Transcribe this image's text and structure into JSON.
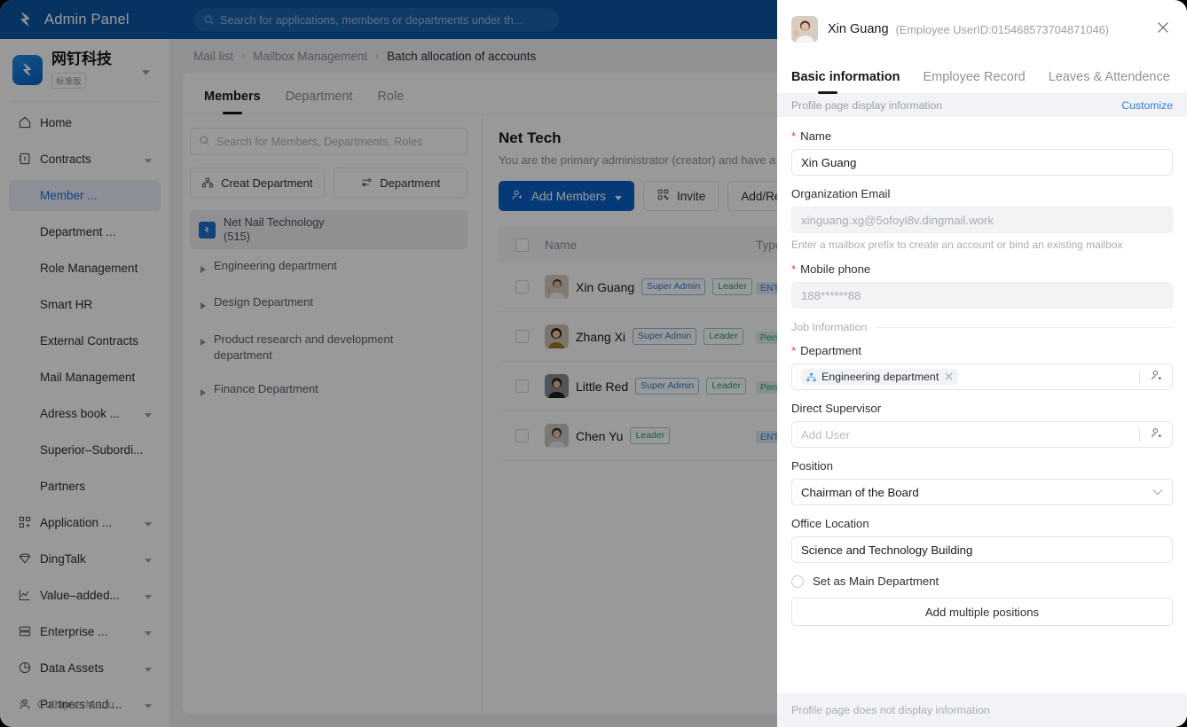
{
  "topbar": {
    "title": "Admin Panel",
    "logo_icon": "dingtalk-wing-icon",
    "search_icon": "search-icon",
    "search_placeholder": "Search for applications, members or departments under th..."
  },
  "sidebar": {
    "org_name": "网钉科技",
    "org_badge": "标准版",
    "org_logo_icon": "dingtalk-wing-icon",
    "caret_icon": "chevron-down-icon",
    "items": [
      {
        "label": "Home",
        "icon": "home-icon",
        "type": "top",
        "caret": false,
        "active": false
      },
      {
        "label": "Contracts",
        "icon": "contract-icon",
        "type": "top",
        "caret": true,
        "active": false
      },
      {
        "label": "Member ...",
        "icon": "",
        "type": "sub",
        "caret": false,
        "active": true
      },
      {
        "label": "Department ...",
        "icon": "",
        "type": "sub",
        "caret": false,
        "active": false
      },
      {
        "label": "Role Management",
        "icon": "",
        "type": "sub",
        "caret": false,
        "active": false
      },
      {
        "label": "Smart HR",
        "icon": "",
        "type": "sub",
        "caret": false,
        "active": false
      },
      {
        "label": "External Contracts",
        "icon": "",
        "type": "sub",
        "caret": false,
        "active": false
      },
      {
        "label": "Mail Management",
        "icon": "",
        "type": "sub",
        "caret": false,
        "active": false
      },
      {
        "label": "Adress book ...",
        "icon": "",
        "type": "sub",
        "caret": true,
        "active": false
      },
      {
        "label": "Superior–Subordi...",
        "icon": "",
        "type": "sub",
        "caret": false,
        "active": false
      },
      {
        "label": "Partners",
        "icon": "",
        "type": "sub",
        "caret": false,
        "active": false
      },
      {
        "label": "Application ...",
        "icon": "apps-add-icon",
        "type": "top",
        "caret": true,
        "active": false
      },
      {
        "label": "DingTalk",
        "icon": "diamond-icon",
        "type": "top",
        "caret": true,
        "active": false
      },
      {
        "label": "Value–added...",
        "icon": "chart-line-icon",
        "type": "top",
        "caret": true,
        "active": false
      },
      {
        "label": "Enterprise ...",
        "icon": "server-icon",
        "type": "top",
        "caret": true,
        "active": false
      },
      {
        "label": "Data Assets",
        "icon": "pie-chart-icon",
        "type": "top",
        "caret": true,
        "active": false
      },
      {
        "label": "Partners and ...",
        "icon": "user-icon",
        "type": "top",
        "caret": true,
        "active": false
      }
    ],
    "collapse_label": "Collapse Menu",
    "collapse_icon": "double-chevron-left-icon"
  },
  "breadcrumb": {
    "items": [
      "Mail list",
      "Mailbox Management",
      "Batch allocation of accounts"
    ],
    "separator_icon": "chevron-right-icon"
  },
  "main": {
    "tabs": [
      {
        "label": "Members",
        "active": true
      },
      {
        "label": "Department",
        "active": false
      },
      {
        "label": "Role",
        "active": false
      }
    ],
    "tree": {
      "search_placeholder": "Search for Members, Departments, Roles",
      "search_icon": "search-icon",
      "buttons": [
        {
          "label": "Creat Department",
          "icon": "org-add-icon"
        },
        {
          "label": "Department",
          "icon": "filter-sliders-icon"
        }
      ],
      "root": {
        "label": "Net Nail Technology",
        "count": "(515)",
        "icon": "dingtalk-square-icon"
      },
      "nodes": [
        {
          "label": "Engineering department",
          "arrow_icon": "triangle-right-icon"
        },
        {
          "label": "Design Department",
          "arrow_icon": "triangle-right-icon"
        },
        {
          "label": "Product research and development department",
          "arrow_icon": "triangle-right-icon"
        },
        {
          "label": "Finance Department",
          "arrow_icon": "triangle-right-icon"
        }
      ]
    },
    "list": {
      "title": "Net Tech",
      "subtitle": "You are the primary administrator (creator) and have a",
      "actions": [
        {
          "label": "Add Members",
          "icon": "user-add-icon",
          "style": "primary",
          "caret": true
        },
        {
          "label": "Invite",
          "icon": "qr-code-icon",
          "style": "ghost",
          "caret": false
        },
        {
          "label": "Add/Reque",
          "icon": "",
          "style": "ghost",
          "caret": false
        }
      ],
      "columns": [
        "Name",
        "Type"
      ],
      "rows": [
        {
          "name": "Xin Guang",
          "avatar_icon": "avatar-xin-guang",
          "badges": [
            {
              "text": "Super Admin",
              "style": "admin"
            },
            {
              "text": "Leader",
              "style": "leader"
            }
          ],
          "type": {
            "text": "ENT ACCT",
            "style": "ent"
          }
        },
        {
          "name": "Zhang Xi",
          "avatar_icon": "avatar-zhang-xi",
          "badges": [
            {
              "text": "Super Admin",
              "style": "admin"
            },
            {
              "text": "Leader",
              "style": "leader"
            }
          ],
          "type": {
            "text": "Personal",
            "style": "personal"
          }
        },
        {
          "name": "Little Red",
          "avatar_icon": "avatar-little-red",
          "badges": [
            {
              "text": "Super Admin",
              "style": "admin"
            },
            {
              "text": "Leader",
              "style": "leader"
            }
          ],
          "type": {
            "text": "Personal",
            "style": "personal"
          }
        },
        {
          "name": "Chen Yu",
          "avatar_icon": "avatar-chen-yu",
          "badges": [
            {
              "text": "Leader",
              "style": "leader"
            }
          ],
          "type": {
            "text": "ENT ACCT",
            "style": "ent"
          }
        }
      ]
    }
  },
  "drawer": {
    "person_name": "Xin Guang",
    "user_id": "(Employee UserID:015468573704871046)",
    "avatar_icon": "avatar-xin-guang",
    "close_icon": "close-icon",
    "tabs": [
      {
        "label": "Basic information",
        "active": true
      },
      {
        "label": "Employee Record",
        "active": false
      },
      {
        "label": "Leaves & Attendence",
        "active": false
      }
    ],
    "notice": "Profile page display information",
    "notice_link": "Customize",
    "fields": {
      "name_label": "Name",
      "name_value": "Xin Guang",
      "email_label": "Organization Email",
      "email_placeholder": "xinguang.xg@5ofoyi8v.dingmail.work",
      "email_hint": "Enter a mailbox prefix to create an account or bind an existing mailbox",
      "phone_label": "Mobile phone",
      "phone_placeholder": "188******88",
      "job_divider": "Job Information",
      "department_label": "Department",
      "department_chip": "Engineering department",
      "department_chip_icon": "org-tree-icon",
      "department_chip_close_icon": "close-small-icon",
      "department_add_icon": "user-add-icon",
      "supervisor_label": "Direct Supervisor",
      "supervisor_placeholder": "Add User",
      "supervisor_add_icon": "user-add-icon",
      "position_label": "Position",
      "position_value": "Chairman of the Board",
      "position_caret_icon": "chevron-down-icon",
      "office_label": "Office Location",
      "office_value": "Science and Technology Building",
      "main_dept_label": "Set as Main Department",
      "main_dept_radio_icon": "radio-unchecked-icon",
      "add_positions_label": "Add multiple positions"
    },
    "footer": "Profile page does not display information"
  },
  "colors": {
    "brand_blue": "#0b55a4",
    "primary_button": "#0b5fc7",
    "accent_link": "#2e7bd6",
    "required_red": "#f04134",
    "tag_green": "#2aa06a"
  }
}
